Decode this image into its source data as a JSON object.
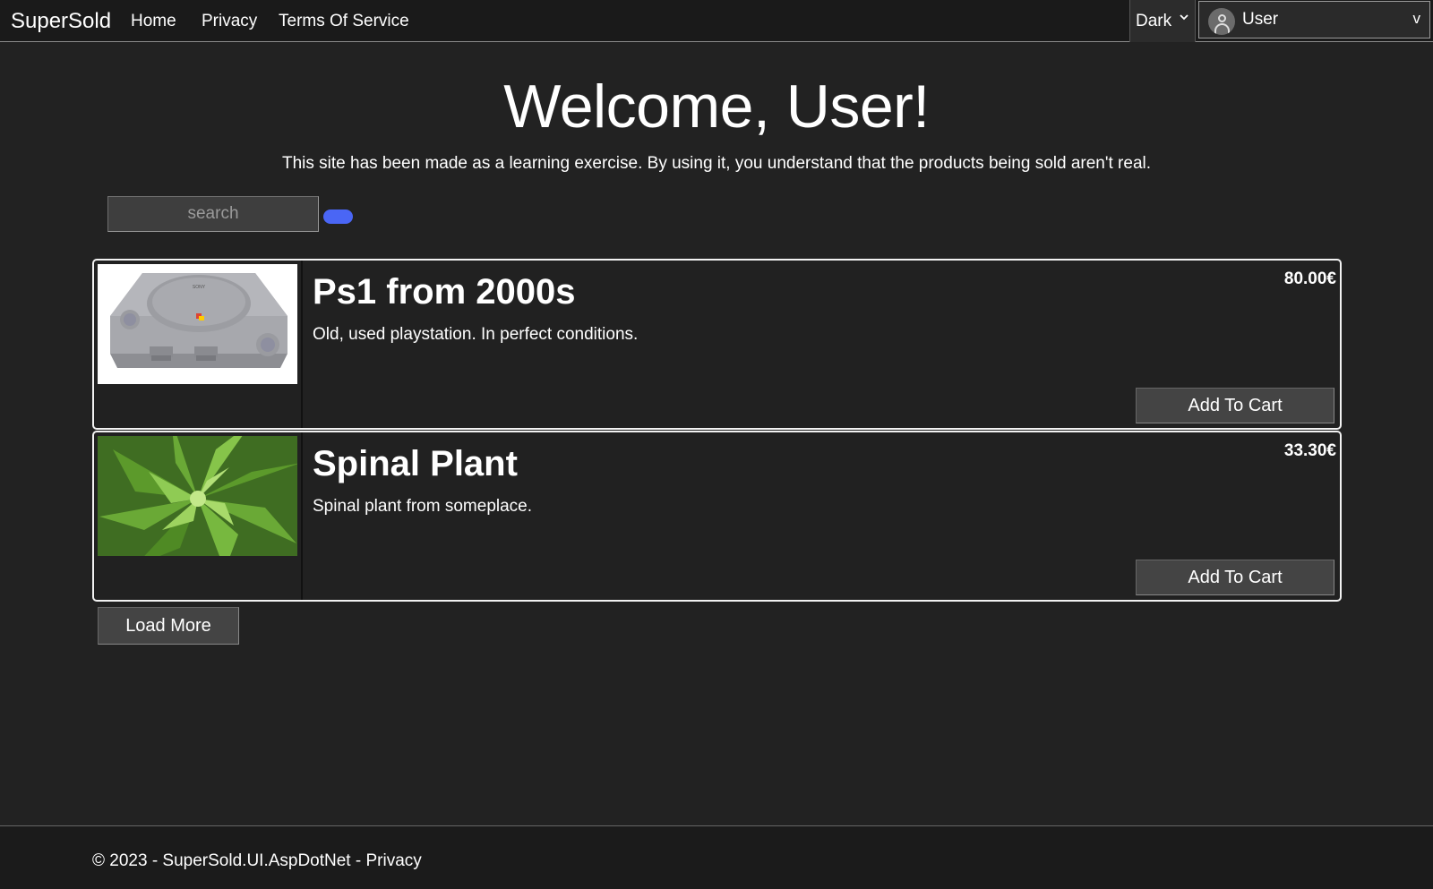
{
  "navbar": {
    "brand": "SuperSold",
    "links": [
      "Home",
      "Privacy",
      "Terms Of Service"
    ],
    "theme": {
      "selected": "Dark",
      "chevron": "⌄"
    },
    "user": {
      "name": "User",
      "chevron": "v",
      "avatar_icon": "user-avatar-icon"
    }
  },
  "hero": {
    "title": "Welcome, User!",
    "disclaimer": "This site has been made as a learning exercise. By using it, you understand that the products being sold aren't real."
  },
  "search": {
    "placeholder": "search",
    "button_color": "#4a66f5"
  },
  "products": [
    {
      "title": "Ps1 from 2000s",
      "description": "Old, used playstation. In perfect conditions.",
      "price": "80.00€",
      "button": "Add To Cart",
      "image": "ps1-console-image"
    },
    {
      "title": "Spinal Plant",
      "description": "Spinal plant from someplace.",
      "price": "33.30€",
      "button": "Add To Cart",
      "image": "spiral-plant-image"
    }
  ],
  "load_more": "Load More",
  "footer": {
    "prefix": "© 2023 - SuperSold.UI.AspDotNet - ",
    "link": "Privacy"
  },
  "colors": {
    "background": "#222222",
    "navbar": "#1a1a1a",
    "accent": "#4a66f5"
  }
}
